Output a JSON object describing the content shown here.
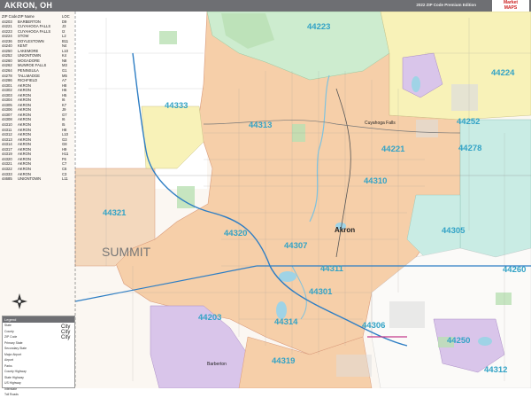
{
  "title": "AKRON, OH",
  "edition": "2022 ZIP Code Premium Edition",
  "logo": {
    "line1": "Market",
    "line2": "MAPS"
  },
  "legend_list": {
    "headers": [
      "ZIP Code",
      "ZIP Name",
      "LOC"
    ],
    "rows": [
      [
        "44203",
        "BARBERTON",
        "D9"
      ],
      [
        "44221",
        "CUYAHOGA FALLS",
        "J3"
      ],
      [
        "44223",
        "CUYAHOGA FALLS",
        "I2"
      ],
      [
        "44224",
        "STOW",
        "L2"
      ],
      [
        "44236",
        "DOYLESTOWN",
        "B11"
      ],
      [
        "44240",
        "KENT",
        "N4"
      ],
      [
        "44250",
        "LAKEMORE",
        "L10"
      ],
      [
        "44252",
        "UNIONTOWN",
        "K4"
      ],
      [
        "44260",
        "MOGADORE",
        "N8"
      ],
      [
        "44262",
        "MUNROE FALLS",
        "M3"
      ],
      [
        "44264",
        "PENINSULA",
        "G1"
      ],
      [
        "44278",
        "TALLMADGE",
        "M5"
      ],
      [
        "44286",
        "RICHFIELD",
        "A7"
      ],
      [
        "44301",
        "AKRON",
        "H8"
      ],
      [
        "44302",
        "AKRON",
        "H6"
      ],
      [
        "44303",
        "AKRON",
        "H5"
      ],
      [
        "44304",
        "AKRON",
        "I6"
      ],
      [
        "44305",
        "AKRON",
        "K7"
      ],
      [
        "44306",
        "AKRON",
        "J9"
      ],
      [
        "44307",
        "AKRON",
        "G7"
      ],
      [
        "44308",
        "AKRON",
        "I6"
      ],
      [
        "44310",
        "AKRON",
        "I5"
      ],
      [
        "44311",
        "AKRON",
        "H8"
      ],
      [
        "44312",
        "AKRON",
        "L10"
      ],
      [
        "44313",
        "AKRON",
        "G3"
      ],
      [
        "44314",
        "AKRON",
        "G8"
      ],
      [
        "44317",
        "AKRON",
        "H9"
      ],
      [
        "44319",
        "AKRON",
        "H11"
      ],
      [
        "44320",
        "AKRON",
        "F6"
      ],
      [
        "44321",
        "AKRON",
        "C7"
      ],
      [
        "44322",
        "AKRON",
        "C6"
      ],
      [
        "44333",
        "AKRON",
        "C3"
      ],
      [
        "44685",
        "UNIONTOWN",
        "L11"
      ]
    ]
  },
  "zip_labels": [
    "44223",
    "44224",
    "44333",
    "44313",
    "44252",
    "44221",
    "44278",
    "44310",
    "44321",
    "44320",
    "44305",
    "44307",
    "44311",
    "44260",
    "44301",
    "44203",
    "44314",
    "44306",
    "44250",
    "44319",
    "44312"
  ],
  "city_names": {
    "akron": "Akron",
    "cuyahoga_falls": "Cuyahoga Falls",
    "barberton": "Barberton",
    "summit": "SUMMIT"
  },
  "key": {
    "header": "Legend",
    "rows": [
      "State",
      "County",
      "ZIP Code",
      "Primary State",
      "Secondary State",
      "Major Airport",
      "Airport",
      "Parks",
      "County Highway",
      "State Highway",
      "US Highway",
      "Interstate",
      "Toll Roads"
    ],
    "city_samples": [
      "City",
      "City",
      "City"
    ]
  },
  "colors": {
    "base": "#f6cfa9",
    "water": "#9fd3e6",
    "highway": "#2e7ec4",
    "zip_text": "#33a3c6"
  }
}
